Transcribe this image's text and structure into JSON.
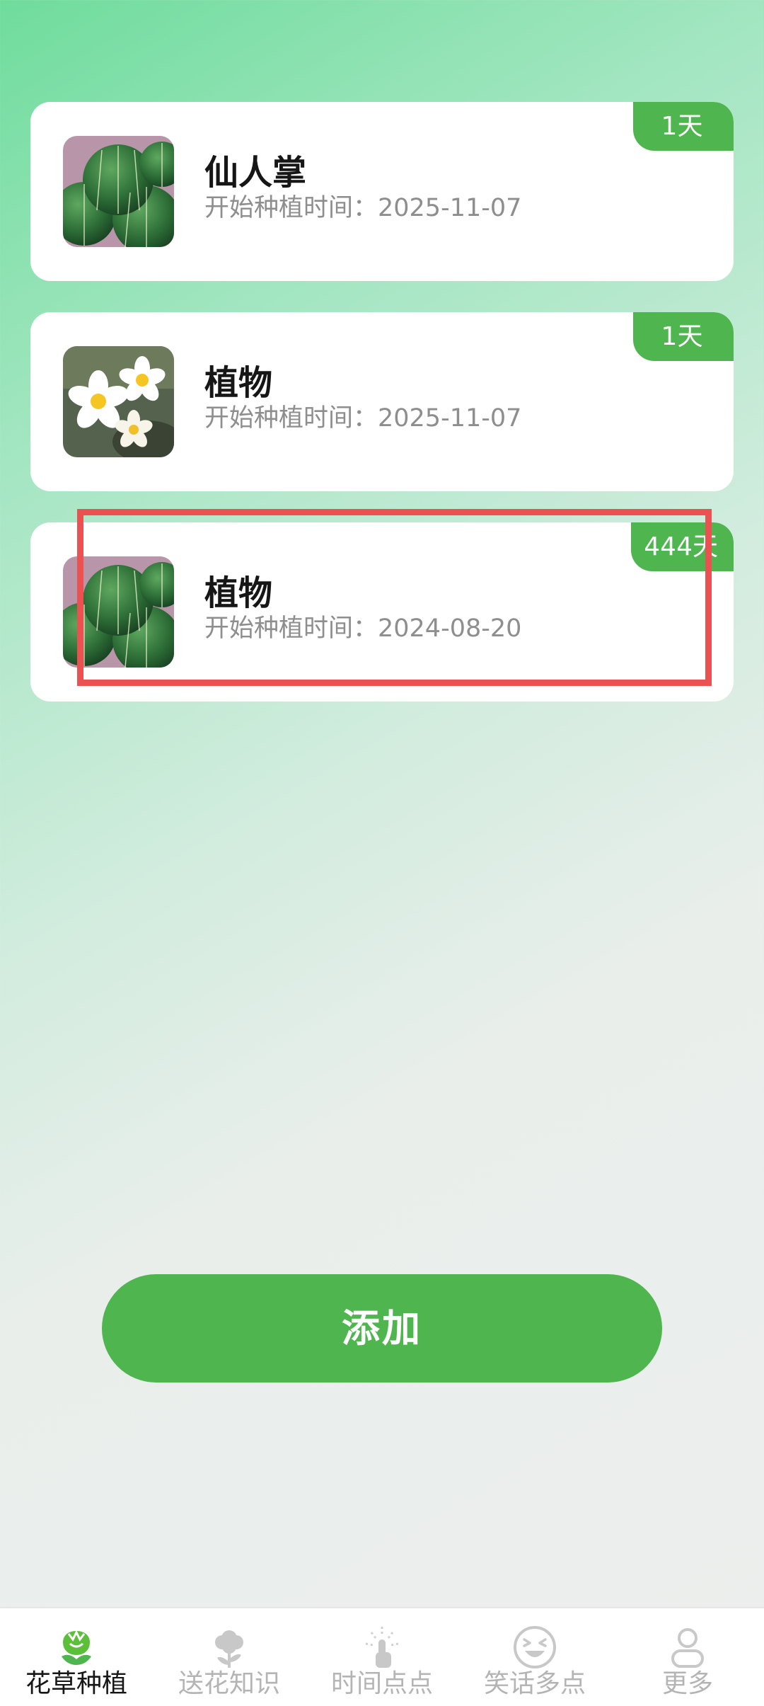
{
  "plants": [
    {
      "name": "仙人掌",
      "date_text": "开始种植时间：2025-11-07",
      "days": "1天",
      "image": "cactus"
    },
    {
      "name": "植物",
      "date_text": "开始种植时间：2025-11-07",
      "days": "1天",
      "image": "frangipani-flower"
    },
    {
      "name": "植物",
      "date_text": "开始种植时间：2024-08-20",
      "days": "444天",
      "image": "cactus"
    }
  ],
  "add_button_label": "添加",
  "tabs": [
    {
      "label": "花草种植",
      "icon": "rose-icon",
      "active": true
    },
    {
      "label": "送花知识",
      "icon": "flower-icon",
      "active": false
    },
    {
      "label": "时间点点",
      "icon": "touch-icon",
      "active": false
    },
    {
      "label": "笑话多点",
      "icon": "laugh-icon",
      "active": false
    },
    {
      "label": "更多",
      "icon": "person-icon",
      "active": false
    }
  ],
  "colors": {
    "accent": "#4fb54e",
    "highlight": "#ea5150",
    "text_primary": "#161616",
    "text_secondary": "#8e8e8e",
    "tab_inactive": "#b4b4b4"
  }
}
